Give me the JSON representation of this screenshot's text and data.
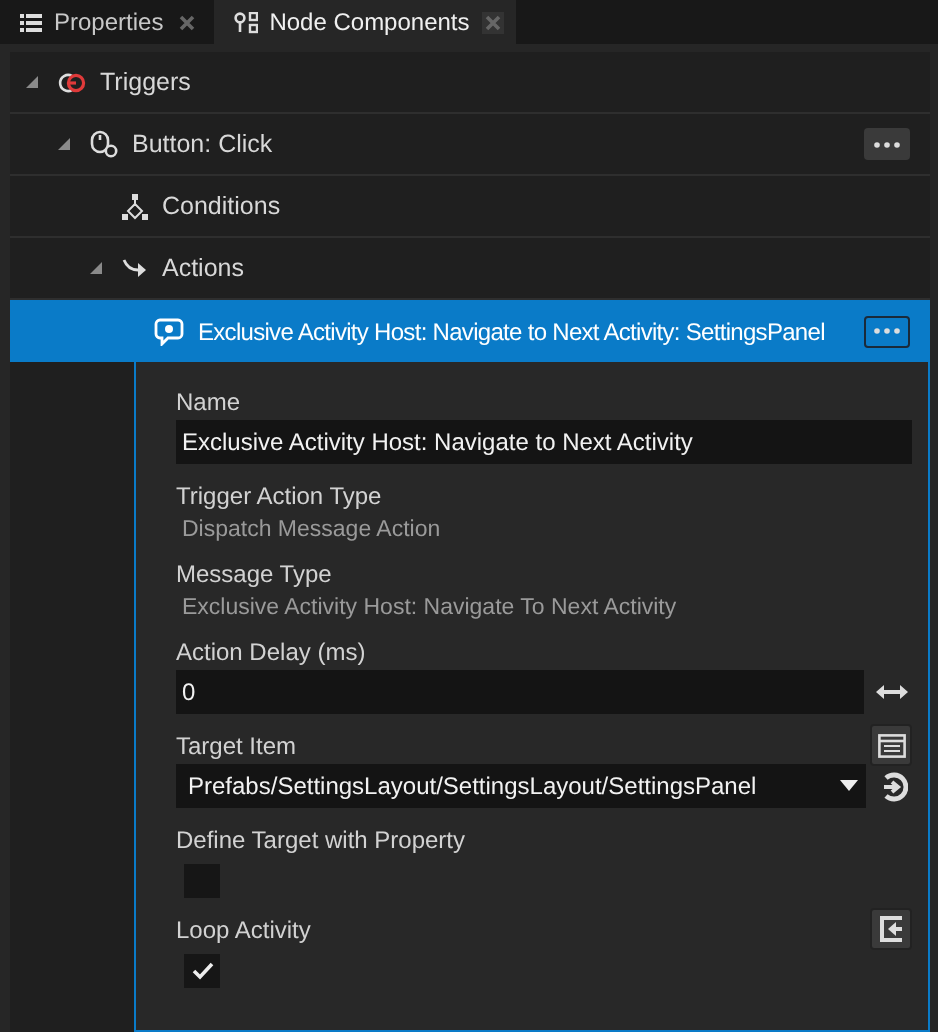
{
  "tabs": [
    {
      "label": "Properties",
      "selected": false
    },
    {
      "label": "Node Components",
      "selected": true
    }
  ],
  "tree": [
    {
      "label": "Triggers",
      "kind": "trigger",
      "expanded": true,
      "selected": false,
      "children": [
        {
          "label": "Button: Click",
          "kind": "event",
          "expanded": true,
          "selected": false,
          "menu": true,
          "children": [
            {
              "label": "Conditions",
              "kind": "conditions",
              "selected": false
            },
            {
              "label": "Actions",
              "kind": "actions",
              "expanded": true,
              "selected": false,
              "children": [
                {
                  "label": "Exclusive Activity Host: Navigate to Next Activity: SettingsPanel",
                  "kind": "action",
                  "selected": true,
                  "menu": true
                }
              ]
            }
          ]
        }
      ]
    }
  ],
  "properties": [
    {
      "kind": "text_field",
      "label": "Name",
      "value": "Exclusive Activity Host: Navigate to Next Activity"
    },
    {
      "kind": "readonly",
      "label": "Trigger Action Type",
      "value": "Dispatch Message Action"
    },
    {
      "kind": "readonly",
      "label": "Message Type",
      "value": "Exclusive Activity Host: Navigate To Next Activity"
    },
    {
      "kind": "text_field",
      "label": "Action Delay (ms)",
      "value": "0",
      "side_button": true
    },
    {
      "kind": "dropdown",
      "label": "Target Item",
      "value": "Prefabs/SettingsLayout/SettingsLayout/SettingsPanel",
      "label_button": true,
      "side_button": true
    },
    {
      "kind": "checkbox",
      "label": "Define Target with Property",
      "checked": false
    },
    {
      "kind": "checkbox",
      "label": "Loop Activity",
      "checked": true,
      "label_button": true
    }
  ]
}
